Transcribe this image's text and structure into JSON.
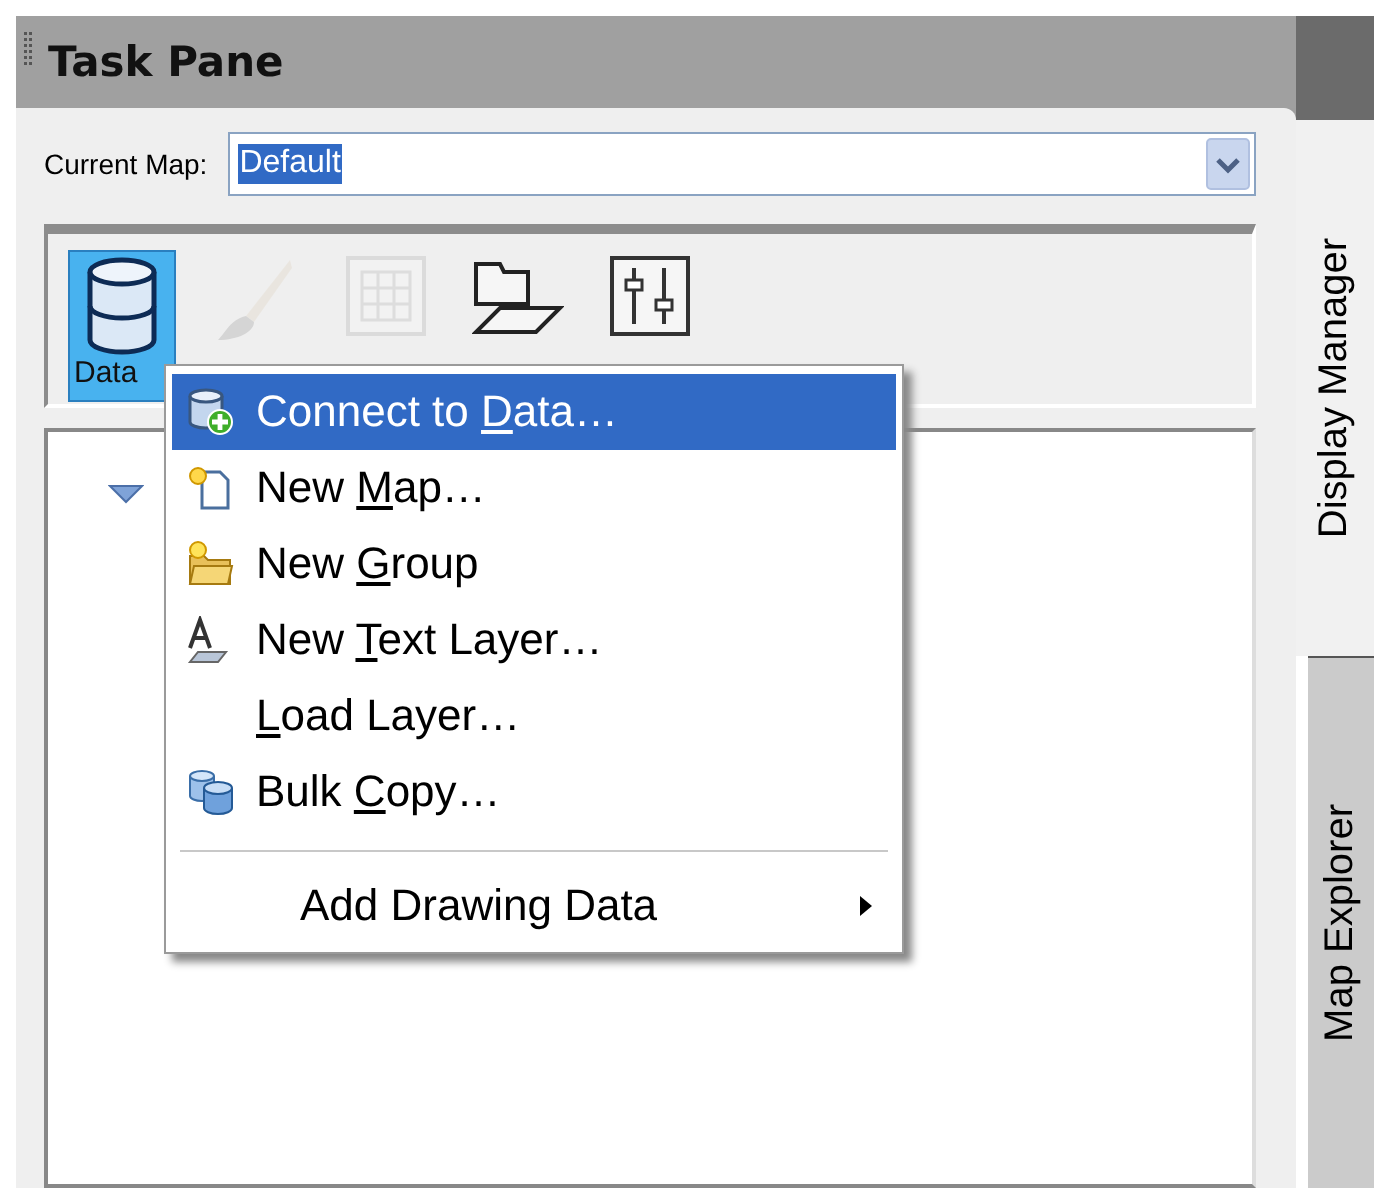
{
  "pane": {
    "title": "Task Pane"
  },
  "current_map": {
    "label": "Current Map:",
    "value": "Default",
    "value_selected": true
  },
  "toolbar": [
    {
      "kind": "data",
      "label": "Data",
      "selected": true,
      "disabled": false
    },
    {
      "kind": "brush",
      "selected": false,
      "disabled": true
    },
    {
      "kind": "grid",
      "selected": false,
      "disabled": true
    },
    {
      "kind": "layers",
      "selected": false,
      "disabled": false
    },
    {
      "kind": "sliders",
      "selected": false,
      "disabled": false
    }
  ],
  "tree": {
    "expanded": true
  },
  "menu": [
    {
      "kind": "connect",
      "before": "Connect to ",
      "key": "D",
      "after": "ata…",
      "selected": true
    },
    {
      "kind": "newmap",
      "before": "New ",
      "key": "M",
      "after": "ap…",
      "selected": false
    },
    {
      "kind": "newgroup",
      "before": "New ",
      "key": "G",
      "after": "roup",
      "selected": false
    },
    {
      "kind": "text",
      "before": "New ",
      "key": "T",
      "after": "ext Layer…",
      "selected": false
    },
    {
      "kind": "none",
      "key": "L",
      "after": "oad Layer…",
      "selected": false
    },
    {
      "kind": "bulk",
      "before": "Bulk ",
      "key": "C",
      "after": "opy…",
      "selected": false
    },
    {
      "kind": "separator"
    },
    {
      "kind": "submenu",
      "before": "Add Drawing Data",
      "selected": false
    }
  ],
  "side_tabs": [
    {
      "label": "Display Manager",
      "selected": true
    },
    {
      "label": "Map Explorer",
      "selected": false
    }
  ]
}
